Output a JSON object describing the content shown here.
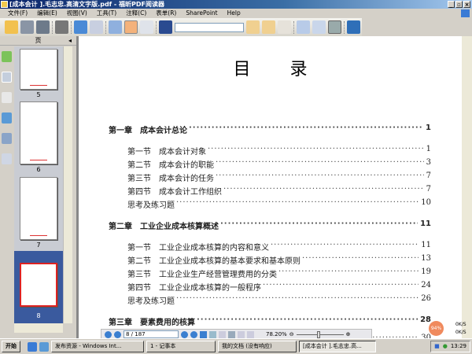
{
  "window": {
    "title": "[成本会计 ].毛志忠.高清文字版.pdf - 福昕PDF阅读器",
    "buttons": [
      "_",
      "▫",
      "×"
    ]
  },
  "menu": [
    "文件(F)",
    "编辑(E)",
    "视图(V)",
    "工具(T)",
    "注释(C)",
    "表单(R)",
    "SharePoint",
    "Help"
  ],
  "sidebar": {
    "header": "页",
    "thumbs": [
      {
        "label": "5"
      },
      {
        "label": "6"
      },
      {
        "label": "7"
      },
      {
        "label": "8",
        "selected": true
      }
    ]
  },
  "document": {
    "title": "目录",
    "toc": [
      {
        "level": "chapter",
        "title": "第一章　成本会计总论",
        "page": "1"
      },
      {
        "level": "section",
        "title": "第一节　成本会计对象",
        "page": "1"
      },
      {
        "level": "section",
        "title": "第二节　成本会计的职能",
        "page": "3"
      },
      {
        "level": "section",
        "title": "第三节　成本会计的任务",
        "page": "7"
      },
      {
        "level": "section",
        "title": "第四节　成本会计工作组织",
        "page": "7"
      },
      {
        "level": "section",
        "title": "思考及练习题",
        "page": "10"
      },
      {
        "level": "chapter",
        "title": "第二章　工业企业成本核算概述",
        "page": "11"
      },
      {
        "level": "section",
        "title": "第一节　工业企业成本核算的内容和意义",
        "page": "11"
      },
      {
        "level": "section",
        "title": "第二节　工业企业成本核算的基本要求和基本原则",
        "page": "13"
      },
      {
        "level": "section",
        "title": "第三节　工业企业生产经营管理费用的分类",
        "page": "19"
      },
      {
        "level": "section",
        "title": "第四节　工业企业成本核算的一般程序",
        "page": "24"
      },
      {
        "level": "section",
        "title": "思考及练习题",
        "page": "26"
      },
      {
        "level": "chapter",
        "title": "第三章　要素费用的核算",
        "page": "28"
      },
      {
        "level": "section",
        "title": "",
        "page": "30"
      }
    ]
  },
  "navbar": {
    "page": "8 / 187",
    "zoom": "78.20%"
  },
  "netmeter": {
    "percent": "94%",
    "up": "0K/S",
    "down": "0K/S"
  },
  "taskbar": {
    "start": "开始",
    "tasks": [
      "发布资源 - Windows Int...",
      "1 - 记事本",
      "我的文档 (没有响应)",
      "[成本会计 ].毛志忠.高..."
    ],
    "clock": "13:29"
  }
}
